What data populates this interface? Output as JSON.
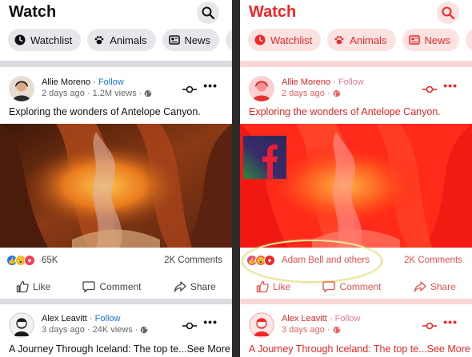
{
  "panels": {
    "left": {
      "title": "Watch",
      "chips": [
        {
          "label": "Watchlist",
          "icon": "clock-icon"
        },
        {
          "label": "Animals",
          "icon": "paw-icon"
        },
        {
          "label": "News",
          "icon": "news-icon"
        }
      ],
      "post1": {
        "author": "Allie Moreno",
        "follow": "Follow",
        "meta": "2 days ago · 1.2M views ·",
        "caption": "Exploring the wonders of Antelope Canyon.",
        "likes": "65K",
        "comments": "2K Comments"
      },
      "actions": {
        "like": "Like",
        "comment": "Comment",
        "share": "Share"
      },
      "post2": {
        "author": "Alex Leavitt",
        "follow": "Follow",
        "meta": "3 days ago · 24K views ·",
        "caption": "A Journey Through Iceland: The top te...",
        "see_more": "See More"
      }
    },
    "right": {
      "title": "Watch",
      "chips": [
        {
          "label": "Watchlist",
          "icon": "clock-icon"
        },
        {
          "label": "Animals",
          "icon": "paw-icon"
        },
        {
          "label": "News",
          "icon": "news-icon"
        }
      ],
      "post1": {
        "author": "Allie Moreno",
        "follow": "Follow",
        "meta": "2 days ago ·",
        "caption": "Exploring the wonders of Antelope Canyon.",
        "likes": "Adam Bell and others",
        "comments": "2K Comments"
      },
      "actions": {
        "like": "Like",
        "comment": "Comment",
        "share": "Share"
      },
      "post2": {
        "author": "Alex Leavitt",
        "follow": "Follow",
        "meta": "3 days ago ·",
        "caption": "A Journey Through Iceland: The top te...",
        "see_more": "See More"
      }
    }
  },
  "colors": {
    "left_accent": "#1877f2",
    "right_accent": "#f02525"
  }
}
